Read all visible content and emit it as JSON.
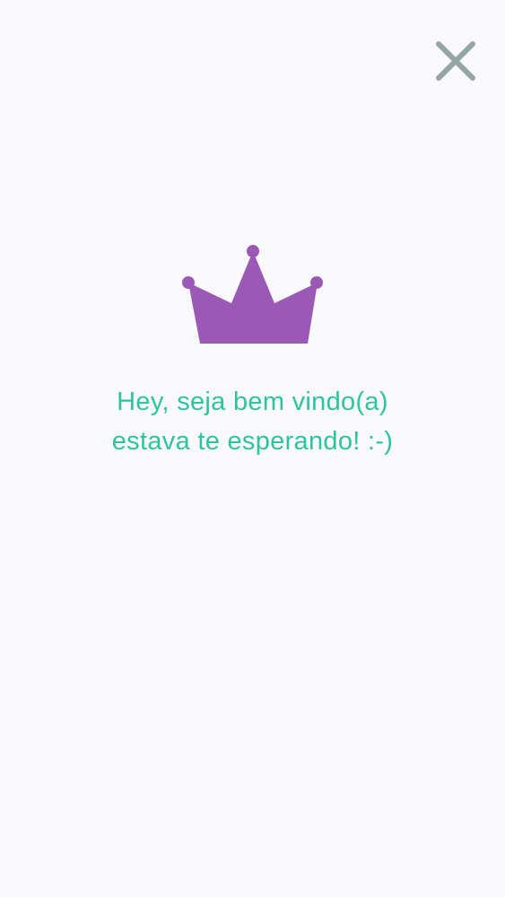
{
  "colors": {
    "background": "#faf9fc",
    "crown": "#9b59b6",
    "text": "#2ec4a0",
    "close_icon": "#95a5a6"
  },
  "icons": {
    "close": "close-icon",
    "crown": "crown-icon"
  },
  "welcome": {
    "line1": "Hey, seja bem vindo(a)",
    "line2": "estava te esperando! :-)"
  }
}
